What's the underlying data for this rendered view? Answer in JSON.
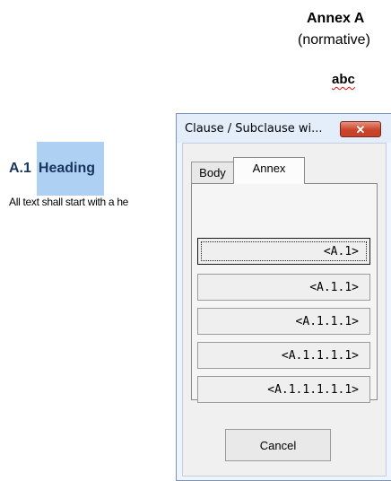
{
  "document": {
    "annex_title": "Annex A",
    "annex_subtitle": "(normative)",
    "misspelled_word": "abc",
    "heading_number": "A.1",
    "heading_text": "Heading",
    "body_text": "All text shall start with a he"
  },
  "dialog": {
    "title": "Clause / Subclause wi...",
    "close_icon": "close-icon",
    "tabs": [
      {
        "label": "Body",
        "selected": false
      },
      {
        "label": "Annex",
        "selected": true
      }
    ],
    "buttons": [
      "<A.1>",
      "<A.1.1>",
      "<A.1.1.1>",
      "<A.1.1.1.1>",
      "<A.1.1.1.1.1>"
    ],
    "cancel_label": "Cancel"
  },
  "colors": {
    "heading_highlight": "#aed0f2",
    "heading_text": "#17365d",
    "close_button": "#c9452a",
    "spell_underline": "#e01010"
  }
}
